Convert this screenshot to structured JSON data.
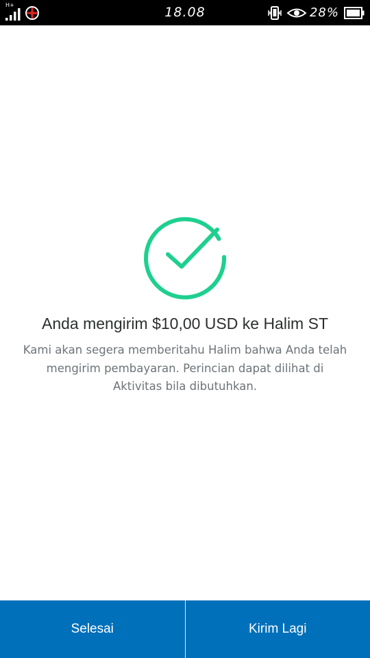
{
  "status_bar": {
    "network_type": "H+",
    "time": "18.08",
    "battery_percent": "28%",
    "icons": [
      "signal-icon",
      "carrier-icon",
      "vibrate-icon",
      "eye-icon",
      "battery-icon"
    ]
  },
  "confirmation": {
    "icon": "checkmark-circle-icon",
    "title": "Anda mengirim $10,00 USD ke Halim ST",
    "message": "Kami akan segera memberitahu Halim bahwa Anda telah mengirim pembayaran. Perincian dapat dilihat di Aktivitas bila dibutuhkan."
  },
  "actions": {
    "done_label": "Selesai",
    "send_again_label": "Kirim Lagi"
  },
  "colors": {
    "accent_green": "#1ed08f",
    "button_blue": "#0070ba",
    "title_text": "#2c2e2f",
    "body_text": "#6c7378"
  }
}
